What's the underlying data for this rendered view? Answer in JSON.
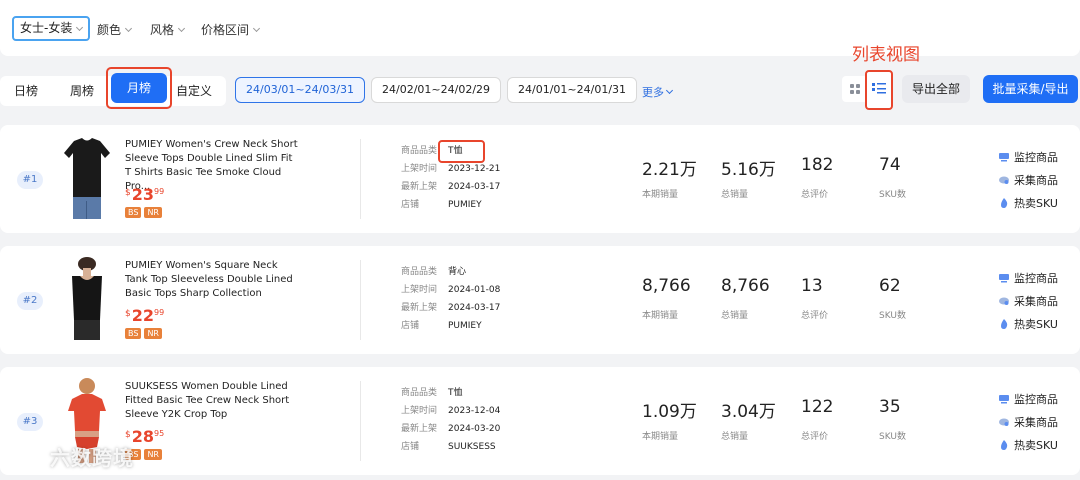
{
  "filters": {
    "category": "女士-女装",
    "items": [
      "颜色",
      "风格",
      "价格区间"
    ]
  },
  "period_tabs": [
    "日榜",
    "周榜",
    "月榜",
    "自定义"
  ],
  "date_ranges": [
    "24/03/01~24/03/31",
    "24/02/01~24/02/29",
    "24/01/01~24/01/31"
  ],
  "more_label": "更多",
  "view_annotation": "列表视图",
  "buttons": {
    "export_all": "导出全部",
    "batch": "批量采集/导出"
  },
  "meta_labels": {
    "category": "商品品类",
    "listed": "上架时间",
    "latest": "最新上架",
    "store": "店铺"
  },
  "stat_labels": {
    "period_sales": "本期销量",
    "total_sales": "总销量",
    "total_reviews": "总评价",
    "sku_count": "SKU数"
  },
  "action_labels": {
    "monitor": "监控商品",
    "collect": "采集商品",
    "hot_sku": "热卖SKU"
  },
  "products": [
    {
      "rank": "#1",
      "title": "PUMIEY Women's Crew Neck Short Sleeve Tops Double Lined Slim Fit T Shirts Basic Tee Smoke Cloud Pro...",
      "currency": "$",
      "price_int": "23",
      "price_dec": "99",
      "badges": [
        "BS",
        "NR"
      ],
      "category": "T恤",
      "listed": "2023-12-21",
      "latest": "2024-03-17",
      "store": "PUMIEY",
      "period_sales": "2.21万",
      "total_sales": "5.16万",
      "total_reviews": "182",
      "sku_count": "74"
    },
    {
      "rank": "#2",
      "title": "PUMIEY Women's Square Neck Tank Top Sleeveless Double Lined Basic Tops Sharp Collection",
      "currency": "$",
      "price_int": "22",
      "price_dec": "99",
      "badges": [
        "BS",
        "NR"
      ],
      "category": "背心",
      "listed": "2024-01-08",
      "latest": "2024-03-17",
      "store": "PUMIEY",
      "period_sales": "8,766",
      "total_sales": "8,766",
      "total_reviews": "13",
      "sku_count": "62"
    },
    {
      "rank": "#3",
      "title": "SUUKSESS Women Double Lined Fitted Basic Tee Crew Neck Short Sleeve Y2K Crop Top",
      "currency": "$",
      "price_int": "28",
      "price_dec": "95",
      "badges": [
        "BS",
        "NR"
      ],
      "category": "T恤",
      "listed": "2023-12-04",
      "latest": "2024-03-20",
      "store": "SUUKSESS",
      "period_sales": "1.09万",
      "total_sales": "3.04万",
      "total_reviews": "122",
      "sku_count": "35"
    }
  ],
  "watermark": "六数跨境"
}
